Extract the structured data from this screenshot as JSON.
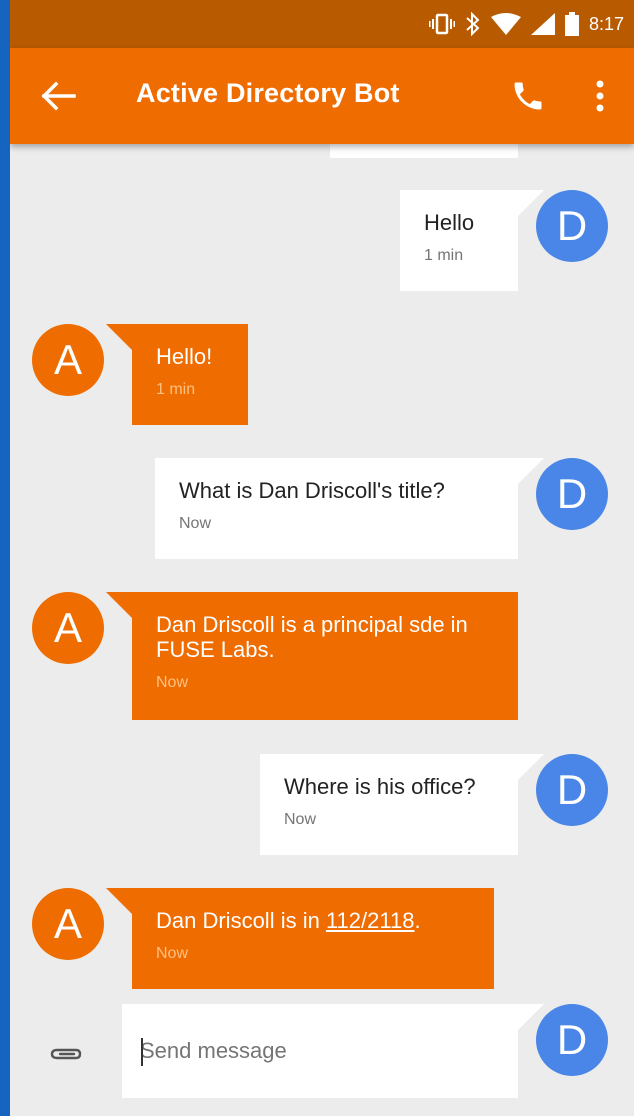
{
  "status_bar": {
    "time": "8:17"
  },
  "app_bar": {
    "title": "Active Directory Bot"
  },
  "messages": [
    {
      "sender": "user",
      "avatar": "D",
      "text": "Hello",
      "time": "1 min"
    },
    {
      "sender": "bot",
      "avatar": "A",
      "text": "Hello!",
      "time": "1 min"
    },
    {
      "sender": "user",
      "avatar": "D",
      "text": "What is Dan Driscoll's title?",
      "time": "Now"
    },
    {
      "sender": "bot",
      "avatar": "A",
      "text": "Dan Driscoll is a principal sde in FUSE Labs.",
      "time": "Now"
    },
    {
      "sender": "user",
      "avatar": "D",
      "text": "Where is his office?",
      "time": "Now"
    },
    {
      "sender": "bot",
      "avatar": "A",
      "text_prefix": "Dan Driscoll is in ",
      "link": "112/2118",
      "text_suffix": ".",
      "time": "Now"
    }
  ],
  "composer": {
    "placeholder": "Send message",
    "avatar": "D"
  },
  "colors": {
    "accent": "#ef6c00",
    "status_bar": "#b85a00",
    "user_avatar": "#4a86e8",
    "background": "#ececec"
  },
  "icons": [
    "vibrate-icon",
    "bluetooth-icon",
    "wifi-icon",
    "signal-icon",
    "battery-icon",
    "back-arrow-icon",
    "phone-icon",
    "more-vert-icon",
    "paperclip-icon"
  ]
}
